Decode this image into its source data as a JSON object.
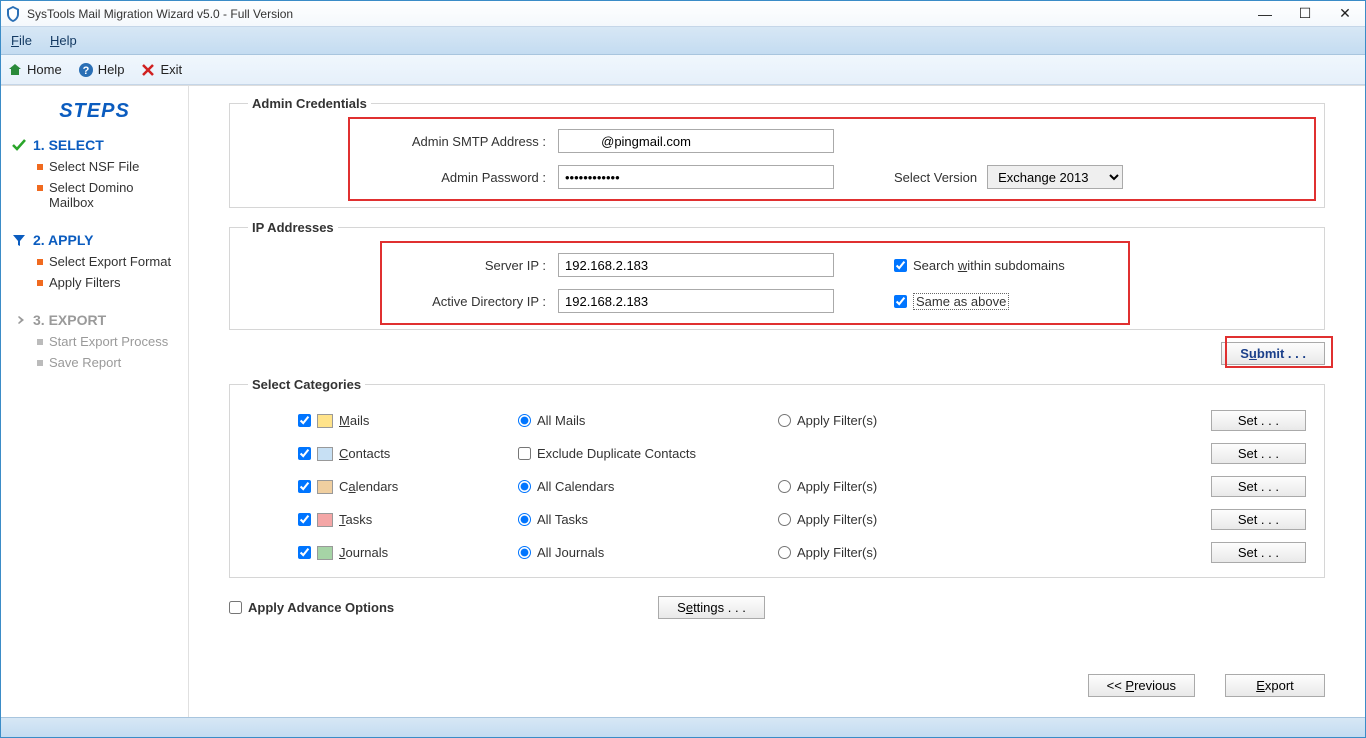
{
  "window": {
    "title": "SysTools Mail Migration Wizard v5.0 - Full Version"
  },
  "menubar": {
    "file": "File",
    "help": "Help"
  },
  "toolbar": {
    "home": "Home",
    "help": "Help",
    "exit": "Exit"
  },
  "sidebar": {
    "title": "STEPS",
    "step1": {
      "label": "1. SELECT",
      "sub1": "Select NSF File",
      "sub2": "Select Domino Mailbox"
    },
    "step2": {
      "label": "2. APPLY",
      "sub1": "Select Export Format",
      "sub2": "Apply Filters"
    },
    "step3": {
      "label": "3. EXPORT",
      "sub1": "Start Export Process",
      "sub2": "Save Report"
    }
  },
  "credentials": {
    "legend": "Admin Credentials",
    "smtp_label": "Admin SMTP Address :",
    "smtp_value": "          @pingmail.com",
    "pwd_label": "Admin Password :",
    "pwd_value": "************",
    "version_label": "Select Version",
    "version_value": "Exchange 2013"
  },
  "ip": {
    "legend": "IP Addresses",
    "server_label": "Server IP :",
    "server_value": "192.168.2.183",
    "ad_label": "Active Directory IP :",
    "ad_value": "192.168.2.183",
    "search_sub": "Search within subdomains",
    "same": "Same as above"
  },
  "submit": "Submit . . .",
  "categories": {
    "legend": "Select Categories",
    "mails": "Mails",
    "all_mails": "All Mails",
    "apply_filters": "Apply Filter(s)",
    "set": "Set . . .",
    "contacts": "Contacts",
    "exclude_dup": "Exclude Duplicate Contacts",
    "calendars": "Calendars",
    "all_calendars": "All Calendars",
    "tasks": "Tasks",
    "all_tasks": "All Tasks",
    "journals": "Journals",
    "all_journals": "All Journals"
  },
  "advance": {
    "label": "Apply Advance Options",
    "settings": "Settings . . ."
  },
  "footer": {
    "previous": "<< Previous",
    "export": "Export"
  }
}
